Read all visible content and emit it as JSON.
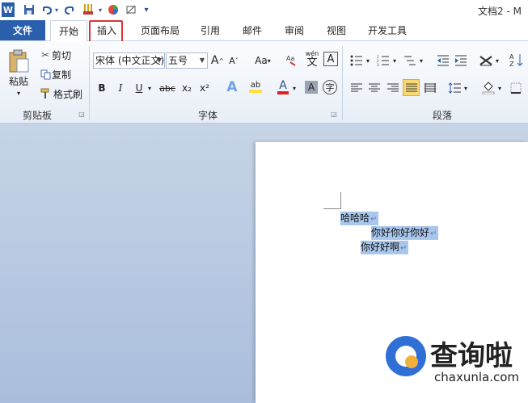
{
  "qat": {
    "word_logo": "W",
    "dropdown": "▾"
  },
  "window": {
    "title": "文档2 - M"
  },
  "tabs": [
    {
      "label": "文件"
    },
    {
      "label": "开始"
    },
    {
      "label": "插入"
    },
    {
      "label": "页面布局"
    },
    {
      "label": "引用"
    },
    {
      "label": "邮件"
    },
    {
      "label": "审阅"
    },
    {
      "label": "视图"
    },
    {
      "label": "开发工具"
    }
  ],
  "highlighted_tab": "插入",
  "clipboard": {
    "paste": "粘贴",
    "cut": "剪切",
    "copy": "复制",
    "format_painter": "格式刷",
    "group": "剪贴板"
  },
  "font": {
    "name": "宋体 (中文正文)",
    "size": "五号",
    "bold": "B",
    "italic": "I",
    "underline": "U",
    "strike": "abc",
    "sub": "x₂",
    "sup": "x²",
    "grow": "A",
    "shrink": "A",
    "case": "Aa",
    "wen": "wén",
    "wen_char": "文",
    "border_a": "A",
    "effects_a": "A",
    "highlight": "ab",
    "color_a": "A",
    "shade_a": "A",
    "circle_char": "字",
    "group": "字体"
  },
  "paragraph": {
    "group": "段落"
  },
  "accent_colors": {
    "file_tab": "#2a5fae",
    "highlight_box": "#d93636",
    "selection": "#a9c7ec",
    "font_color": "#e02020"
  },
  "document": {
    "lines": [
      {
        "text": "哈哈哈",
        "mark": "↵"
      },
      {
        "text": "你好你好你好",
        "mark": "↵"
      },
      {
        "text": "你好好啊",
        "mark": "↵"
      }
    ]
  },
  "watermark": {
    "brand": "查询啦",
    "url": "chaxunla.com"
  }
}
